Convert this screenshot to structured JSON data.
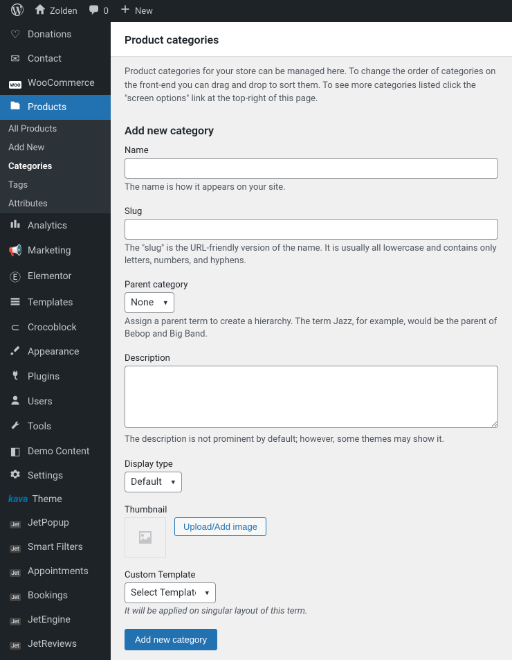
{
  "topbar": {
    "site_name": "Zolden",
    "comments_count": "0",
    "new_label": "New"
  },
  "sidebar": {
    "items": [
      {
        "icon": "heart",
        "label": "Donations"
      },
      {
        "icon": "mail",
        "label": "Contact"
      },
      {
        "icon": "woo",
        "label": "WooCommerce"
      },
      {
        "icon": "product",
        "label": "Products",
        "active": true
      },
      {
        "icon": "chart",
        "label": "Analytics"
      },
      {
        "icon": "megaphone",
        "label": "Marketing"
      },
      {
        "icon": "elementor",
        "label": "Elementor"
      },
      {
        "icon": "templates",
        "label": "Templates"
      },
      {
        "icon": "croco",
        "label": "Crocoblock"
      },
      {
        "icon": "brush",
        "label": "Appearance"
      },
      {
        "icon": "plug",
        "label": "Plugins"
      },
      {
        "icon": "user",
        "label": "Users"
      },
      {
        "icon": "wrench",
        "label": "Tools"
      },
      {
        "icon": "demo",
        "label": "Demo Content"
      },
      {
        "icon": "settings",
        "label": "Settings"
      },
      {
        "icon": "kava",
        "label": "Theme",
        "prefix": "kava"
      },
      {
        "icon": "jet",
        "label": "JetPopup"
      },
      {
        "icon": "jet",
        "label": "Smart Filters"
      },
      {
        "icon": "jet",
        "label": "Appointments"
      },
      {
        "icon": "jet",
        "label": "Bookings"
      },
      {
        "icon": "jet",
        "label": "JetEngine"
      },
      {
        "icon": "jet",
        "label": "JetReviews"
      }
    ],
    "sub_items": [
      {
        "label": "All Products"
      },
      {
        "label": "Add New"
      },
      {
        "label": "Categories",
        "current": true
      },
      {
        "label": "Tags"
      },
      {
        "label": "Attributes"
      }
    ]
  },
  "page": {
    "title": "Product categories",
    "intro": "Product categories for your store can be managed here. To change the order of categories on the front-end you can drag and drop to sort them. To see more categories listed click the \"screen options\" link at the top-right of this page.",
    "form_heading": "Add new category",
    "fields": {
      "name": {
        "label": "Name",
        "help": "The name is how it appears on your site."
      },
      "slug": {
        "label": "Slug",
        "help": "The \"slug\" is the URL-friendly version of the name. It is usually all lowercase and contains only letters, numbers, and hyphens."
      },
      "parent": {
        "label": "Parent category",
        "selected": "None",
        "help": "Assign a parent term to create a hierarchy. The term Jazz, for example, would be the parent of Bebop and Big Band."
      },
      "description": {
        "label": "Description",
        "help": "The description is not prominent by default; however, some themes may show it."
      },
      "display_type": {
        "label": "Display type",
        "selected": "Default"
      },
      "thumbnail": {
        "label": "Thumbnail",
        "button": "Upload/Add image"
      },
      "template": {
        "label": "Custom Template",
        "selected": "Select Template...",
        "help": "It will be applied on singular layout of this term."
      }
    },
    "submit_label": "Add new category"
  }
}
